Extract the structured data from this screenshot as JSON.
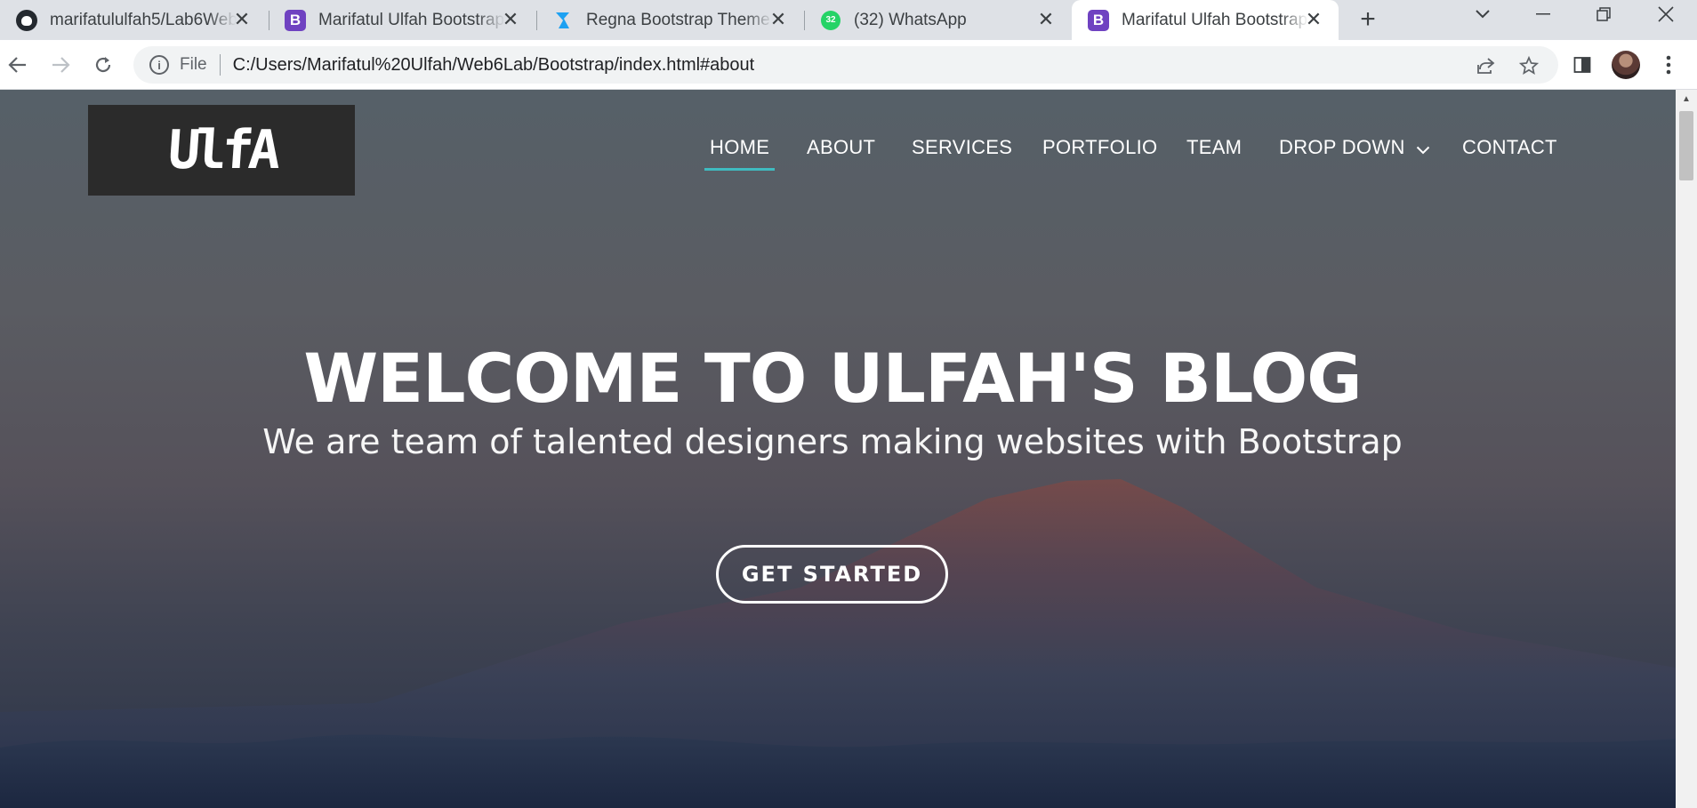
{
  "browser": {
    "tabs": [
      {
        "title": "marifatululfah5/Lab6Web",
        "favicon": "github-icon"
      },
      {
        "title": "Marifatul Ulfah Bootstrap",
        "favicon": "bootstrap-icon"
      },
      {
        "title": "Regna Bootstrap Theme |",
        "favicon": "regna-icon"
      },
      {
        "title": "(32) WhatsApp",
        "favicon": "whatsapp-icon",
        "badge": "32"
      },
      {
        "title": "Marifatul Ulfah Bootstrap",
        "favicon": "bootstrap-icon",
        "active": true
      }
    ],
    "address": {
      "scheme_label": "File",
      "url": "C:/Users/Marifatul%20Ulfah/Web6Lab/Bootstrap/index.html#about"
    }
  },
  "page": {
    "logo_text": "UlfA",
    "nav": {
      "home": "HOME",
      "about": "ABOUT",
      "services": "SERVICES",
      "portfolio": "PORTFOLIO",
      "team": "TEAM",
      "dropdown": "DROP DOWN",
      "contact": "CONTACT"
    },
    "hero": {
      "title": "WELCOME TO ULFAH'S BLOG",
      "subtitle": "We are team of talented designers making websites with Bootstrap",
      "cta": "GET STARTED"
    }
  },
  "colors": {
    "accent": "#3fbbc0",
    "bootstrap_purple": "#6f42c1",
    "whatsapp_green": "#25d366"
  }
}
